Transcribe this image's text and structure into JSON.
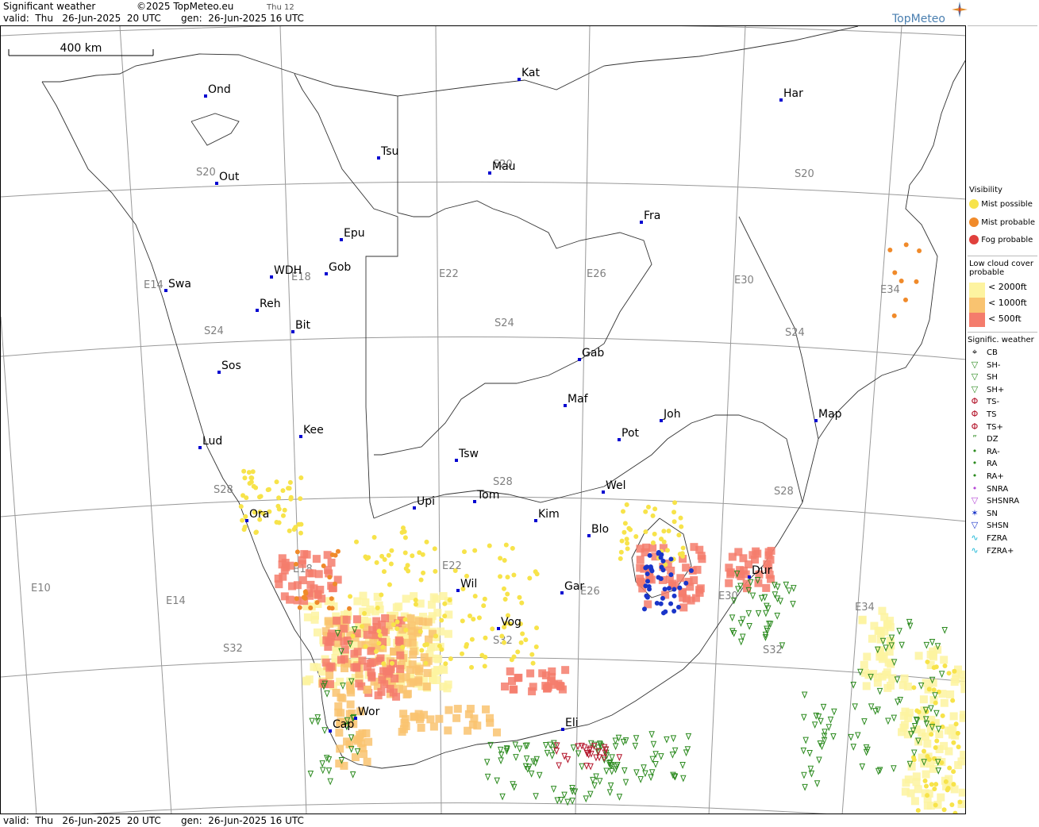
{
  "header": {
    "product": "Significant weather",
    "copyright": "©2025 TopMeteo.eu",
    "day_tag": "Thu 12",
    "valid": "valid:  Thu   26-Jun-2025  20 UTC",
    "gen": "gen:  26-Jun-2025 16 UTC",
    "brand": "TopMeteo"
  },
  "footer": {
    "valid": "valid:  Thu   26-Jun-2025  20 UTC",
    "gen": "gen:  26-Jun-2025 16 UTC"
  },
  "map": {
    "scale_label": "400 km",
    "meridian_labels": [
      "E10",
      "E14",
      "E14",
      "E18",
      "E18",
      "E22",
      "E22",
      "E26",
      "E26",
      "E30",
      "E30",
      "E34",
      "E34"
    ],
    "parallel_labels": [
      "S20",
      "S20",
      "S20",
      "S24",
      "S24",
      "S24",
      "S28",
      "S28",
      "S28",
      "S32",
      "S32",
      "S32"
    ],
    "cities": [
      "Ond",
      "Kat",
      "Har",
      "Tsu",
      "Mau",
      "Out",
      "Fra",
      "Epu",
      "WDH",
      "Gob",
      "Swa",
      "Reh",
      "Bit",
      "Gab",
      "Sos",
      "Maf",
      "Joh",
      "Map",
      "Lud",
      "Kee",
      "Pot",
      "Tsw",
      "Wel",
      "Tom",
      "Upi",
      "Ora",
      "Kim",
      "Blo",
      "Dur",
      "Wil",
      "Gar",
      "Vog",
      "Wor",
      "Cap",
      "Eli"
    ]
  },
  "legend": {
    "visibility_title": "Visibility",
    "visibility": [
      "Mist possible",
      "Mist probable",
      "Fog probable"
    ],
    "low_cloud_title": "Low cloud cover probable",
    "low_cloud": [
      "< 2000ft",
      "< 1000ft",
      "<   500ft"
    ],
    "sigwx_title": "Signific. weather",
    "sigwx": [
      "CB",
      "SH-",
      "SH",
      "SH+",
      "TS-",
      "TS",
      "TS+",
      "DZ",
      "RA-",
      "RA",
      "RA+",
      "SNRA",
      "SHSNRA",
      "SN",
      "SHSN",
      "FZRA",
      "FZRA+"
    ]
  },
  "colors": {
    "mist_possible": "#f7e34a",
    "mist_probable": "#f08a2a",
    "fog_probable": "#e0403c",
    "cloud_2000": "#fdf3a0",
    "cloud_1000": "#f9c370",
    "cloud_500": "#f47c6c",
    "showers": "#2b8a1e",
    "thunder": "#b3142a",
    "snow": "#1a35c9",
    "fzra": "#18b6d6",
    "snra": "#b546d6",
    "city_dot": "#0000d0",
    "brand": "#4a7fb0"
  }
}
